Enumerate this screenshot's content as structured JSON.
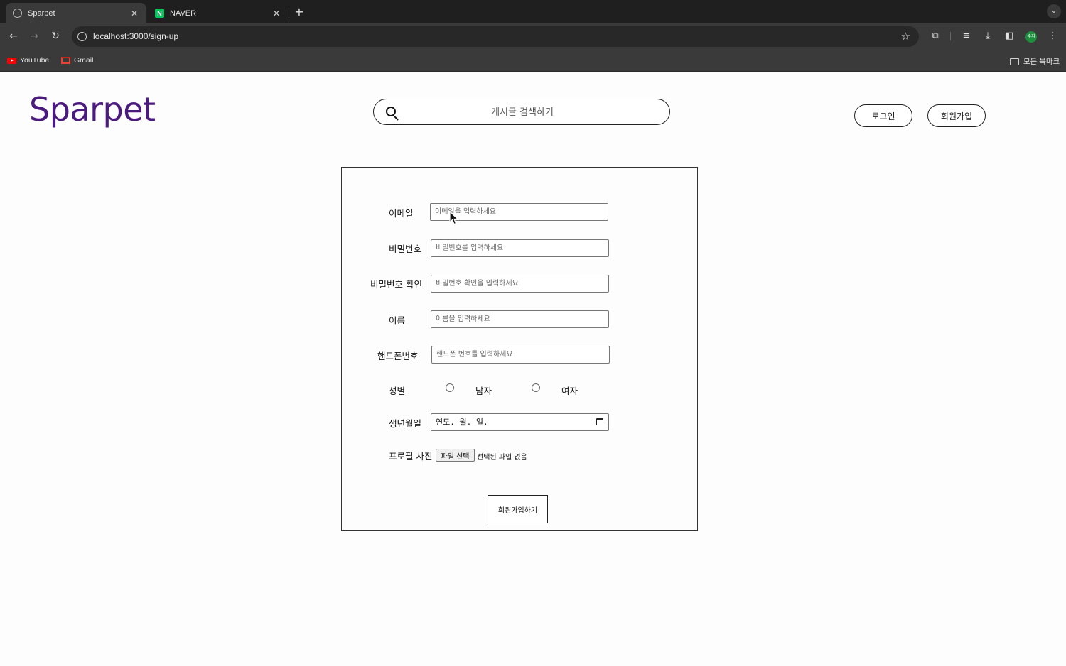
{
  "browser": {
    "tabs": [
      {
        "title": "Sparpet",
        "active": true,
        "icon": "globe-icon"
      },
      {
        "title": "NAVER",
        "active": false,
        "icon": "naver-icon",
        "icon_glyph": "N"
      }
    ],
    "close_glyph": "✕",
    "new_tab_glyph": "+",
    "url": "localhost:3000/sign-up",
    "bookmarks": [
      {
        "label": "YouTube",
        "icon": "youtube-icon"
      },
      {
        "label": "Gmail",
        "icon": "gmail-icon"
      }
    ],
    "all_bookmarks": "모든 북마크",
    "profile_initial": "수지"
  },
  "header": {
    "logo": "Sparpet",
    "search_placeholder": "게시글 검색하기",
    "login_label": "로그인",
    "signup_label": "회원가입"
  },
  "form": {
    "email": {
      "label": "이메일",
      "placeholder": "이메일을 입력하세요"
    },
    "password": {
      "label": "비밀번호",
      "placeholder": "비밀번호를 입력하세요"
    },
    "password_confirm": {
      "label": "비밀번호 확인",
      "placeholder": "비밀번호 확인을 입력하세요"
    },
    "name": {
      "label": "이름",
      "placeholder": "이름을 입력하세요"
    },
    "phone": {
      "label": "핸드폰번호",
      "placeholder": "핸드폰 번호를 입력하세요"
    },
    "gender": {
      "label": "성별",
      "options": [
        "남자",
        "여자"
      ]
    },
    "birth": {
      "label": "생년월일",
      "value": "연도. 월. 일."
    },
    "profile": {
      "label": "프로필 사진",
      "button": "파일 선택",
      "status": "선택된 파일 없음"
    },
    "submit_label": "회원가입하기"
  },
  "colors": {
    "logo": "#4b1a7e",
    "chrome_bg": "#1f1f1f",
    "toolbar_bg": "#3a3a3a"
  }
}
